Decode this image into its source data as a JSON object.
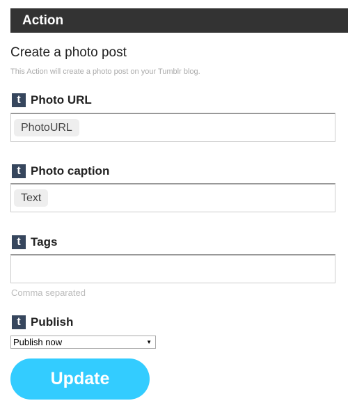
{
  "header": {
    "title": "Action"
  },
  "action": {
    "title": "Create a photo post",
    "description": "This Action will create a photo post on your Tumblr blog."
  },
  "icon": {
    "name": "tumblr-icon",
    "glyph": "t",
    "color": "#36465d"
  },
  "fields": {
    "photo_url": {
      "label": "Photo URL",
      "ingredient": "PhotoURL"
    },
    "photo_caption": {
      "label": "Photo caption",
      "ingredient": "Text"
    },
    "tags": {
      "label": "Tags",
      "value": "",
      "hint": "Comma separated"
    },
    "publish": {
      "label": "Publish",
      "selected": "Publish now"
    }
  },
  "buttons": {
    "update": "Update"
  },
  "colors": {
    "header_bg": "#333333",
    "button_bg": "#33ccff",
    "tumblr_blue": "#36465d"
  }
}
